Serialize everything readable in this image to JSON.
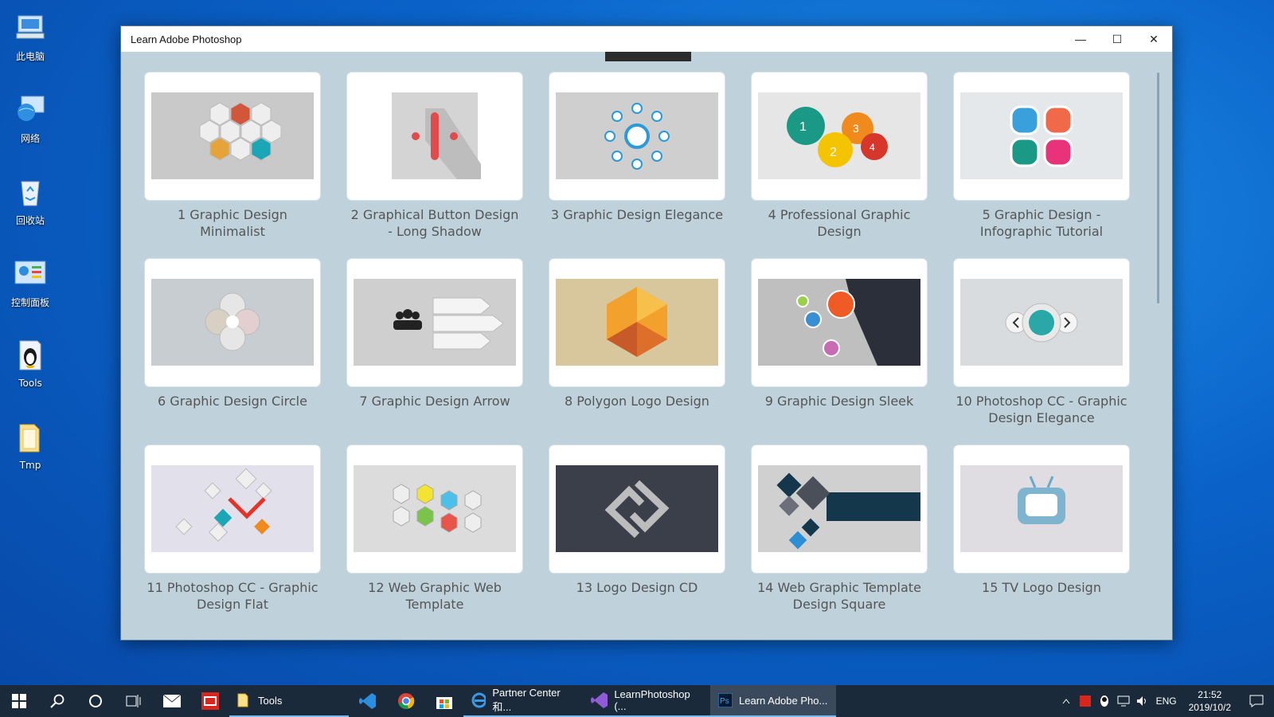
{
  "desktop": {
    "icons": [
      {
        "label": "此电脑",
        "icon": "computer-icon"
      },
      {
        "label": "网络",
        "icon": "network-icon"
      },
      {
        "label": "回收站",
        "icon": "recycle-bin-icon"
      },
      {
        "label": "控制面板",
        "icon": "control-panel-icon"
      },
      {
        "label": "Tools",
        "icon": "tools-app-icon"
      },
      {
        "label": "Tmp",
        "icon": "folder-icon"
      }
    ]
  },
  "window": {
    "title": "Learn Adobe Photoshop",
    "controls": {
      "minimize": "—",
      "maximize": "☐",
      "close": "✕"
    }
  },
  "lessons": [
    {
      "title": "1 Graphic Design Minimalist",
      "bg": "#c9c9c9"
    },
    {
      "title": "2 Graphical Button Design - Long Shadow",
      "bg": "#d4d4d4"
    },
    {
      "title": "3 Graphic Design Elegance",
      "bg": "#cfcfcf"
    },
    {
      "title": "4 Professional Graphic Design",
      "bg": "#e6e6e6"
    },
    {
      "title": "5 Graphic Design - Infographic Tutorial",
      "bg": "#e4e8ea"
    },
    {
      "title": "6 Graphic Design Circle",
      "bg": "#c7cdd1"
    },
    {
      "title": "7 Graphic Design Arrow",
      "bg": "#cfcfcf"
    },
    {
      "title": "8 Polygon Logo Design",
      "bg": "#d8c69c"
    },
    {
      "title": "9 Graphic Design Sleek",
      "bg": "#bfbfbf"
    },
    {
      "title": "10 Photoshop CC - Graphic Design Elegance",
      "bg": "#d8dcdf"
    },
    {
      "title": "11 Photoshop CC - Graphic Design Flat",
      "bg": "#e2e0ea"
    },
    {
      "title": "12 Web Graphic Web Template",
      "bg": "#dcdcdc"
    },
    {
      "title": "13 Logo Design CD",
      "bg": "#3a3f4a"
    },
    {
      "title": "14 Web Graphic Template Design Square",
      "bg": "#d0d0d0"
    },
    {
      "title": "15 TV Logo Design",
      "bg": "#e0dde2"
    }
  ],
  "taskbar": {
    "tools_label": "Tools",
    "partner_center": "Partner Center 和...",
    "learnphotoshop_vs": "LearnPhotoshop (...",
    "learn_adobe": "Learn Adobe Pho...",
    "language": "ENG",
    "time": "21:52",
    "date": "2019/10/2"
  }
}
